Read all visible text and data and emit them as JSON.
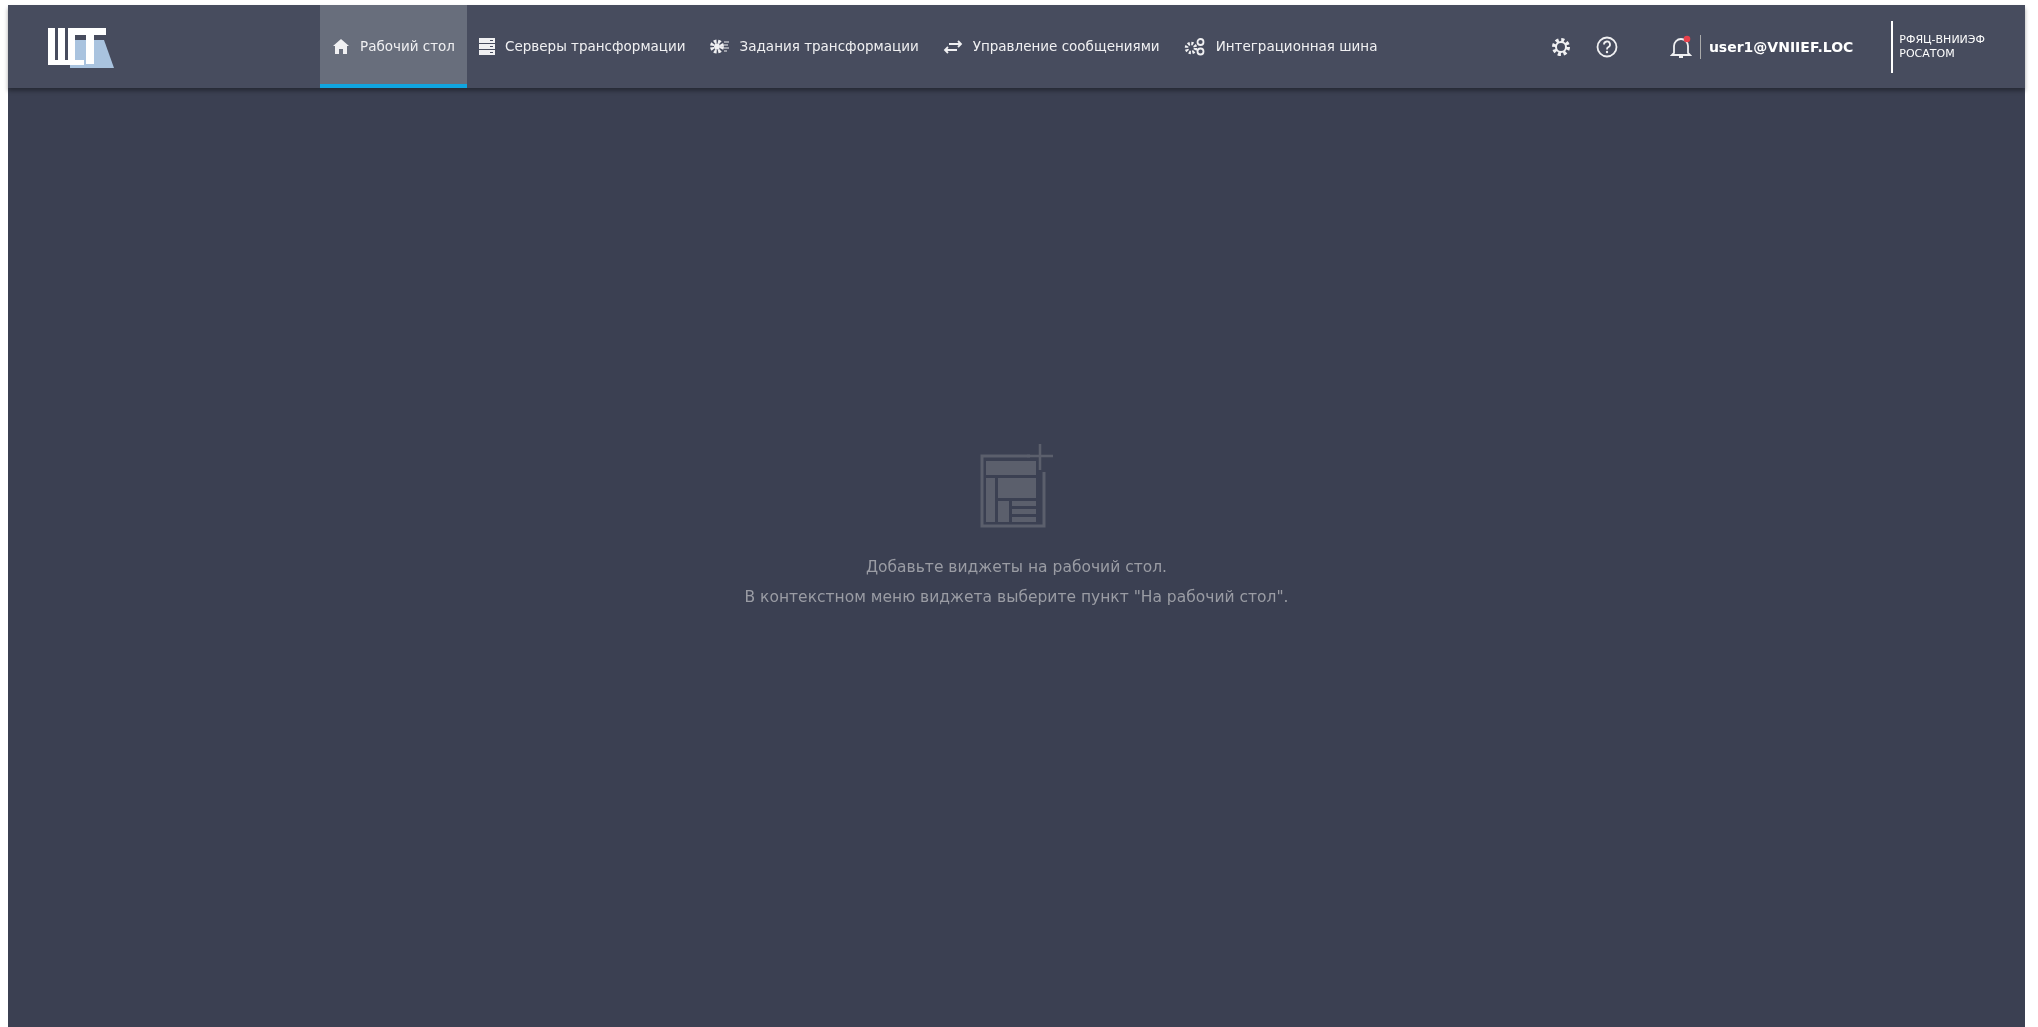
{
  "header": {
    "nav": [
      {
        "label": "Рабочий стол",
        "selected": true
      },
      {
        "label": "Серверы трансформации",
        "selected": false
      },
      {
        "label": "Задания трансформации",
        "selected": false
      },
      {
        "label": "Управление сообщениями",
        "selected": false
      },
      {
        "label": "Интеграционная шина",
        "selected": false
      }
    ],
    "notifications": {
      "unread": true
    },
    "user": "user1@VNIIEF.LOC",
    "org": [
      "РФЯЦ-ВНИИЭФ",
      "РОСАТОМ"
    ]
  },
  "empty_state": {
    "lines": [
      "Добавьте виджеты на рабочий стол.",
      "В контекстном меню виджета выберите пункт \"На рабочий стол\"."
    ]
  }
}
